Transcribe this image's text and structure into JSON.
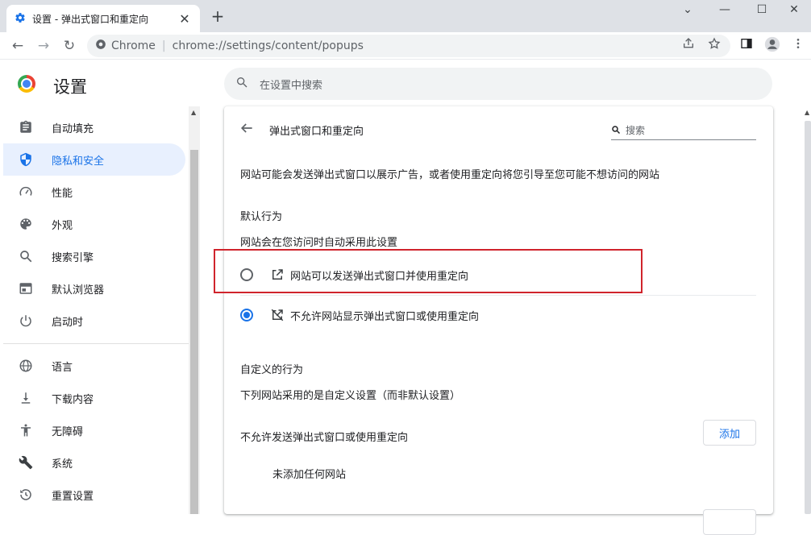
{
  "tab": {
    "title": "设置 - 弹出式窗口和重定向",
    "close_glyph": "✕"
  },
  "new_tab_glyph": "+",
  "window_controls": {
    "chevron": "⌄",
    "minimize": "—",
    "maximize": "☐",
    "close": "✕"
  },
  "toolbar": {
    "back": "←",
    "forward": "→",
    "reload": "↻",
    "site_label": "Chrome",
    "separator": "|",
    "url": "chrome://settings/content/popups"
  },
  "header": {
    "title": "设置",
    "search_placeholder": "在设置中搜索"
  },
  "sidebar": {
    "items": [
      {
        "label": "自动填充",
        "icon": "clipboard-icon"
      },
      {
        "label": "隐私和安全",
        "icon": "shield-icon",
        "active": true
      },
      {
        "label": "性能",
        "icon": "speedometer-icon"
      },
      {
        "label": "外观",
        "icon": "palette-icon"
      },
      {
        "label": "搜索引擎",
        "icon": "search-icon"
      },
      {
        "label": "默认浏览器",
        "icon": "browser-icon"
      },
      {
        "label": "启动时",
        "icon": "power-icon"
      },
      {
        "label": "语言",
        "icon": "globe-icon"
      },
      {
        "label": "下载内容",
        "icon": "download-icon"
      },
      {
        "label": "无障碍",
        "icon": "accessibility-icon"
      },
      {
        "label": "系统",
        "icon": "wrench-icon"
      },
      {
        "label": "重置设置",
        "icon": "history-icon"
      }
    ]
  },
  "main": {
    "title": "弹出式窗口和重定向",
    "search_placeholder": "搜索",
    "description": "网站可能会发送弹出式窗口以展示广告，或者使用重定向将您引导至您可能不想访问的网站",
    "default_behavior": {
      "heading": "默认行为",
      "subheading": "网站会在您访问时自动采用此设置",
      "options": [
        {
          "label": "网站可以发送弹出式窗口并使用重定向",
          "checked": false
        },
        {
          "label": "不允许网站显示弹出式窗口或使用重定向",
          "checked": true
        }
      ]
    },
    "custom_behavior": {
      "heading": "自定义的行为",
      "subheading": "下列网站采用的是自定义设置（而非默认设置）",
      "block_list_label": "不允许发送弹出式窗口或使用重定向",
      "add_button": "添加",
      "empty_text": "未添加任何网站"
    }
  },
  "colors": {
    "accent": "#1a73e8",
    "highlight": "#d0242c",
    "active_bg": "#e8f0fe"
  }
}
